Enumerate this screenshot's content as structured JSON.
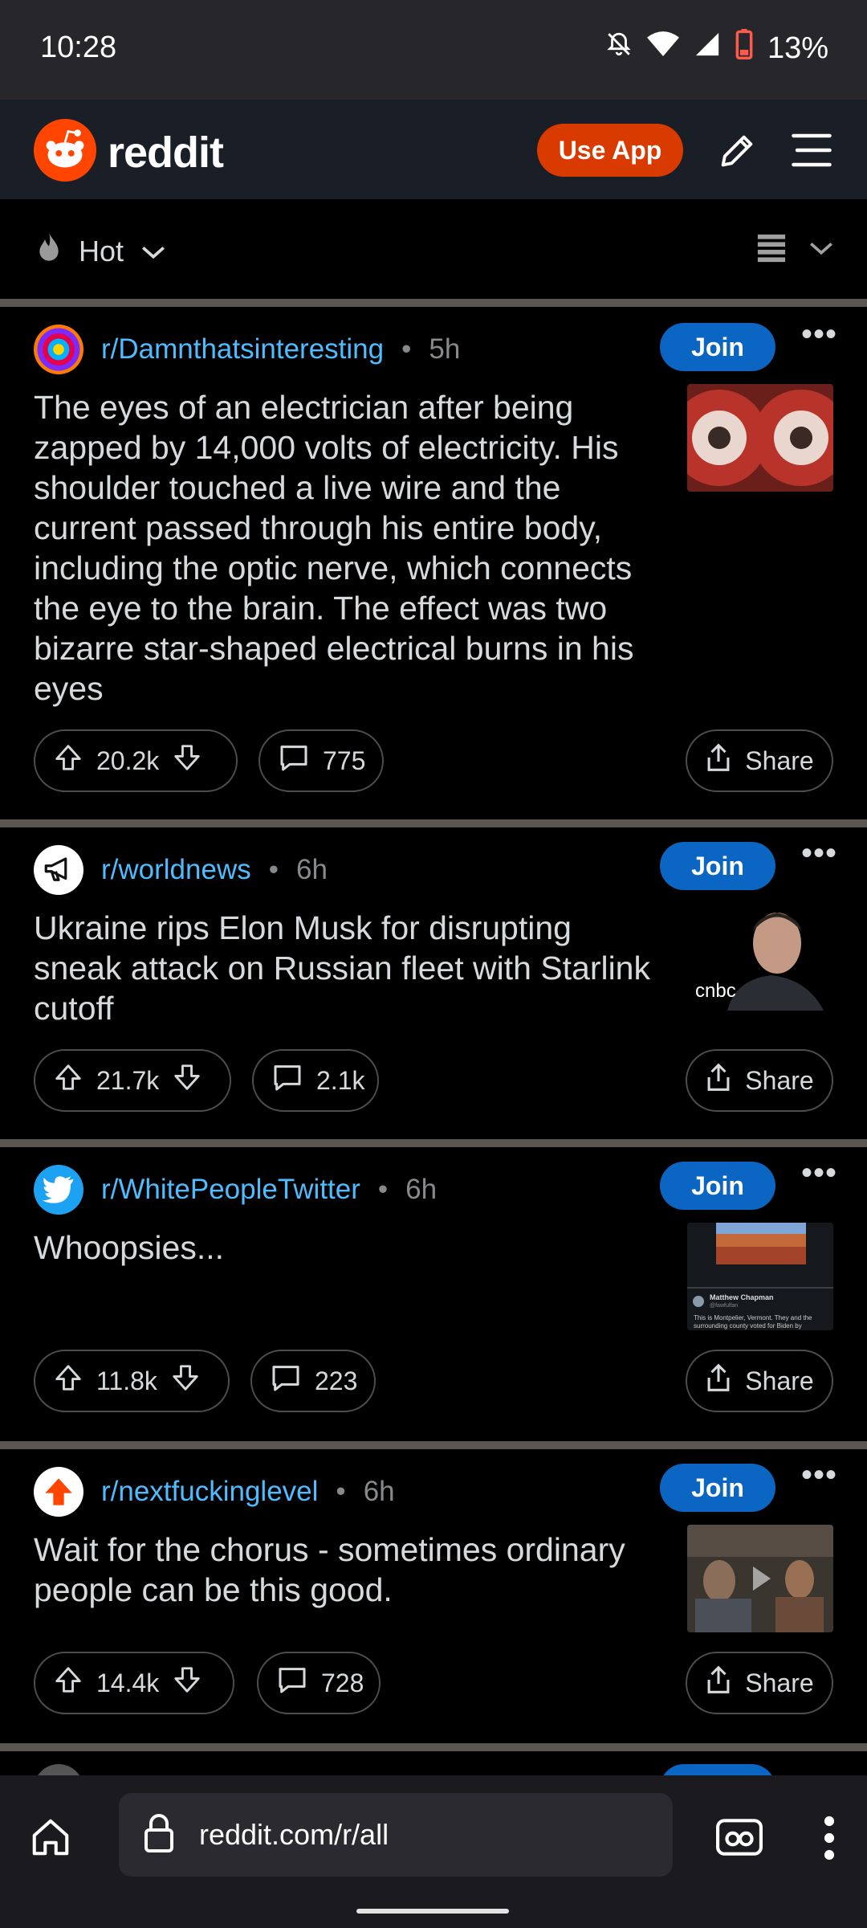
{
  "status_bar": {
    "time": "10:28",
    "battery": "13%"
  },
  "header": {
    "logo_text": "reddit",
    "use_app_label": "Use App"
  },
  "sort": {
    "label": "Hot"
  },
  "posts": [
    {
      "subreddit": "r/Damnthatsinteresting",
      "time": "5h",
      "join_label": "Join",
      "title": "The eyes of an electrician after being zapped by 14,000 volts of electricity. His shoulder touched a live wire and the current passed through his entire body, including the optic nerve, which connects the eye to the brain. The effect was two bizarre star-shaped electrical burns in his eyes",
      "votes": "20.2k",
      "comments": "775",
      "share_label": "Share"
    },
    {
      "subreddit": "r/worldnews",
      "time": "6h",
      "join_label": "Join",
      "title": "Ukraine rips Elon Musk for disrupting sneak attack on Russian fleet with Starlink cutoff",
      "thumb_caption": "cnbc",
      "votes": "21.7k",
      "comments": "2.1k",
      "share_label": "Share"
    },
    {
      "subreddit": "r/WhitePeopleTwitter",
      "time": "6h",
      "join_label": "Join",
      "title": "Whoopsies...",
      "thumb_name": "Matthew Chapman",
      "thumb_handle": "@fawfulfan",
      "thumb_text": "This is Montpelier, Vermont. They and the surrounding county voted for Biden by",
      "votes": "11.8k",
      "comments": "223",
      "share_label": "Share"
    },
    {
      "subreddit": "r/nextfuckinglevel",
      "time": "6h",
      "join_label": "Join",
      "title": "Wait for the chorus - sometimes ordinary people can be this good.",
      "votes": "14.4k",
      "comments": "728",
      "share_label": "Share"
    }
  ],
  "browser": {
    "url": "reddit.com/r/all"
  }
}
